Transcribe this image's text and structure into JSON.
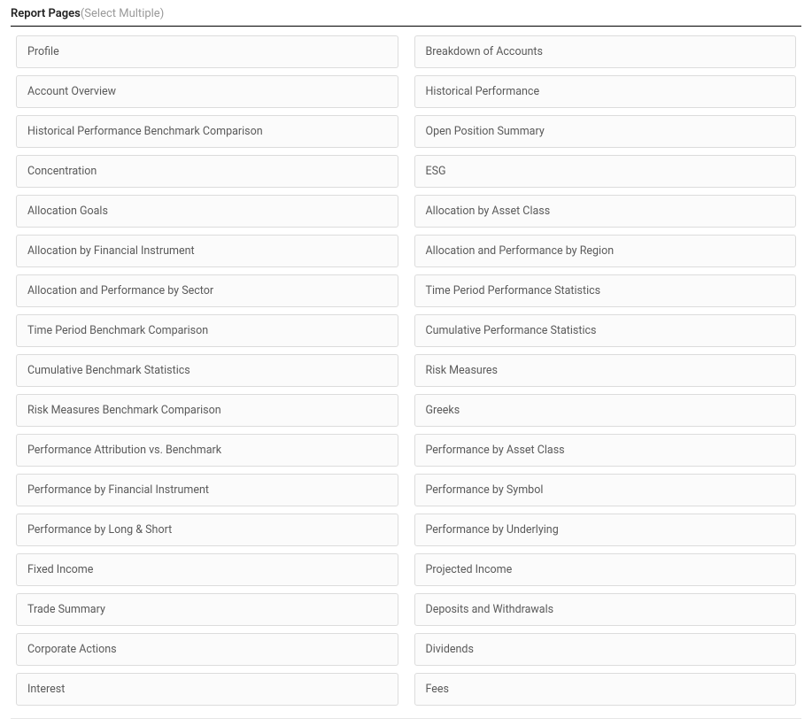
{
  "section": {
    "title": "Report Pages",
    "hint": "(Select Multiple)"
  },
  "options": {
    "left": [
      "Profile",
      "Account Overview",
      "Historical Performance Benchmark Comparison",
      "Concentration",
      "Allocation Goals",
      "Allocation by Financial Instrument",
      "Allocation and Performance by Sector",
      "Time Period Benchmark Comparison",
      "Cumulative Benchmark Statistics",
      "Risk Measures Benchmark Comparison",
      "Performance Attribution vs. Benchmark",
      "Performance by Financial Instrument",
      "Performance by Long & Short",
      "Fixed Income",
      "Trade Summary",
      "Corporate Actions",
      "Interest"
    ],
    "right": [
      "Breakdown of Accounts",
      "Historical Performance",
      "Open Position Summary",
      "ESG",
      "Allocation by Asset Class",
      "Allocation and Performance by Region",
      "Time Period Performance Statistics",
      "Cumulative Performance Statistics",
      "Risk Measures",
      "Greeks",
      "Performance by Asset Class",
      "Performance by Symbol",
      "Performance by Underlying",
      "Projected Income",
      "Deposits and Withdrawals",
      "Dividends",
      "Fees"
    ]
  }
}
